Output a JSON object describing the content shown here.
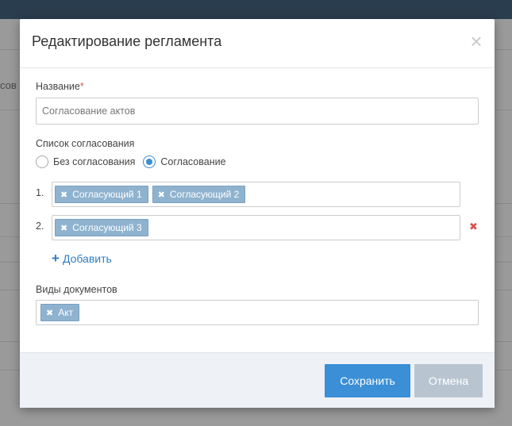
{
  "background": {
    "partial_text": "сов"
  },
  "modal": {
    "title": "Редактирование регламента",
    "close_glyph": "×"
  },
  "name_field": {
    "label": "Название",
    "required_mark": "*",
    "value": "Согласование актов"
  },
  "approval": {
    "label": "Список согласования",
    "options": [
      {
        "label": "Без согласования",
        "checked": false
      },
      {
        "label": "Согласование",
        "checked": true
      }
    ],
    "rows": [
      {
        "number": "1.",
        "approvers": [
          "Согласующий 1",
          "Согласующий 2"
        ]
      },
      {
        "number": "2.",
        "approvers": [
          "Согласующий 3"
        ]
      }
    ],
    "remove_glyph": "✖",
    "add_label": "Добавить",
    "add_glyph": "+"
  },
  "doc_types": {
    "label": "Виды документов",
    "tags": [
      "Акт"
    ]
  },
  "tag_remove_glyph": "✖",
  "footer": {
    "save_label": "Сохранить",
    "cancel_label": "Отмена"
  },
  "colors": {
    "primary": "#3a8fd6",
    "tag": "#8fb3cf",
    "danger": "#d9534f",
    "cancel": "#b8c5d1",
    "topbar": "#2a3d4e"
  }
}
